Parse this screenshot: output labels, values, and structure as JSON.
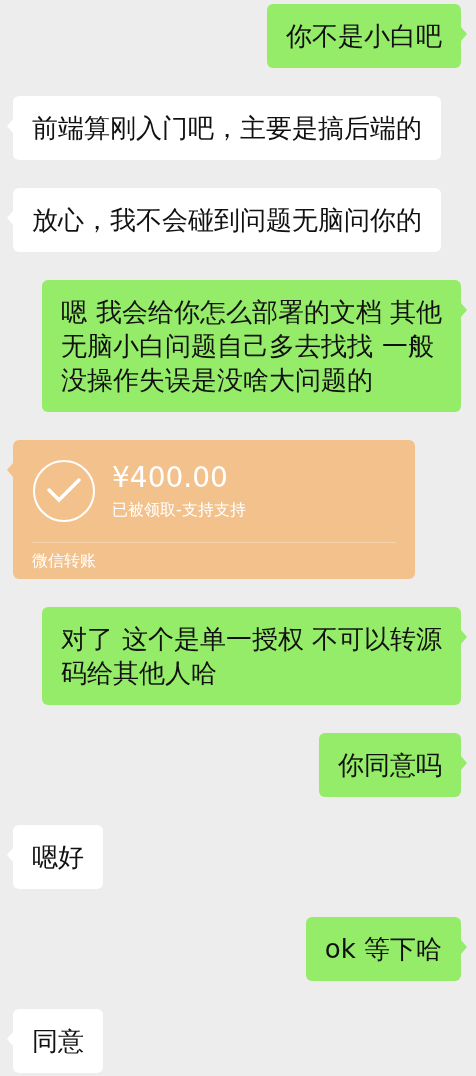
{
  "messages": [
    {
      "kind": "text",
      "from_me": true,
      "lines": [
        "你不是小白吧"
      ]
    },
    {
      "kind": "text",
      "from_me": false,
      "lines": [
        "前端算刚入门吧，主要是搞后端的"
      ]
    },
    {
      "kind": "text",
      "from_me": false,
      "lines": [
        "放心，我不会碰到问题无脑问你的"
      ]
    },
    {
      "kind": "text",
      "from_me": true,
      "lines": [
        "嗯 我会给你怎么部署的文档 其他",
        "无脑小白问题自己多去找找 一般",
        "没操作失误是没啥大问题的"
      ]
    },
    {
      "kind": "transfer",
      "from_me": false,
      "amount": "¥400.00",
      "status": "已被领取-支持支持",
      "footer": "微信转账"
    },
    {
      "kind": "text",
      "from_me": true,
      "lines": [
        "对了 这个是单一授权 不可以转源",
        "码给其他人哈"
      ]
    },
    {
      "kind": "text",
      "from_me": true,
      "lines": [
        "你同意吗"
      ]
    },
    {
      "kind": "text",
      "from_me": false,
      "lines": [
        "嗯好"
      ]
    },
    {
      "kind": "text",
      "from_me": true,
      "lines": [
        "ok 等下哈"
      ]
    },
    {
      "kind": "text",
      "from_me": false,
      "lines": [
        "同意"
      ]
    }
  ]
}
